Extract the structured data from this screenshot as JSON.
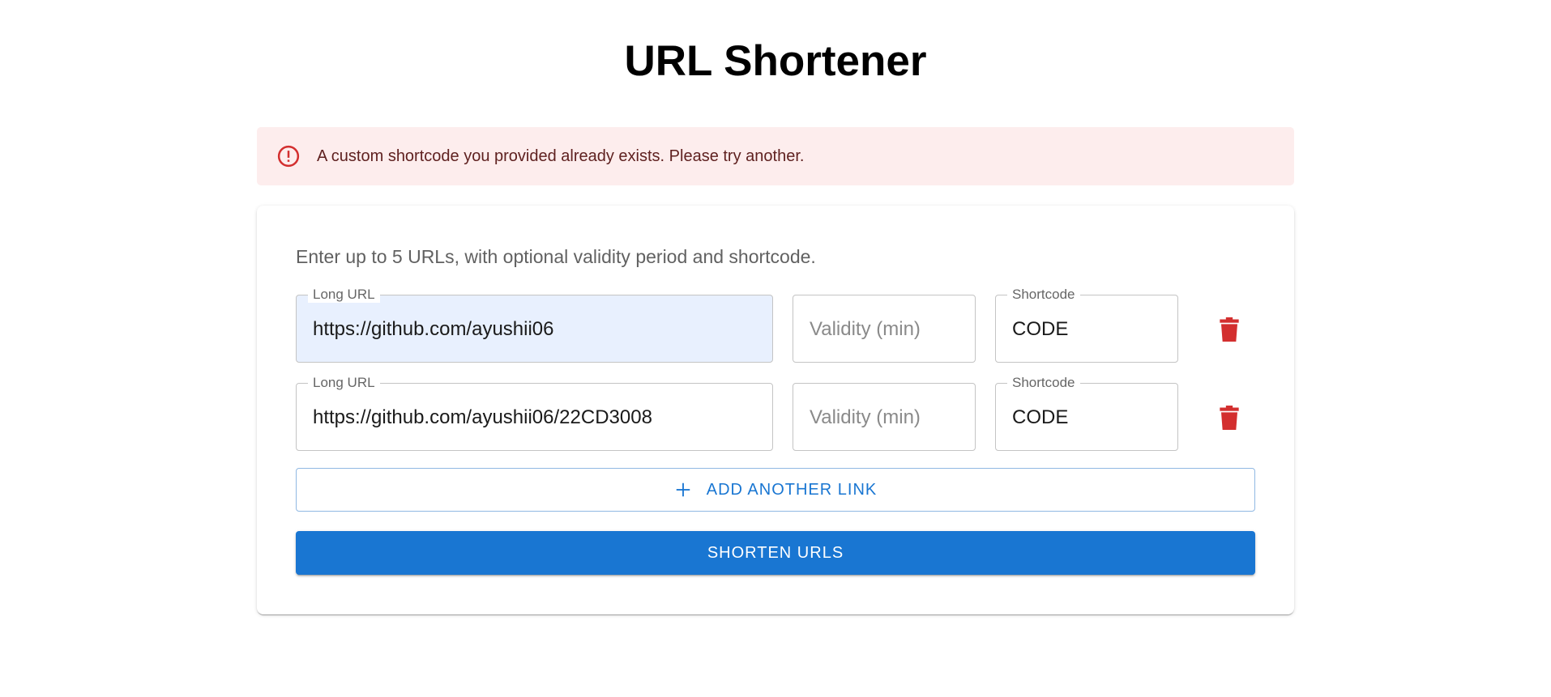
{
  "page": {
    "title": "URL Shortener"
  },
  "alert": {
    "message": "A custom shortcode you provided already exists. Please try another.",
    "icon": "error-outline-icon",
    "background": "#fdeded",
    "icon_color": "#d32f2f"
  },
  "form": {
    "instructions": "Enter up to 5 URLs, with optional validity period and shortcode.",
    "rows": [
      {
        "url_label": "Long URL",
        "url_value": "https://github.com/ayushii06",
        "validity_placeholder": "Validity (min)",
        "shortcode_label": "Shortcode",
        "shortcode_value": "CODE"
      },
      {
        "url_label": "Long URL",
        "url_value": "https://github.com/ayushii06/22CD3008",
        "validity_placeholder": "Validity (min)",
        "shortcode_label": "Shortcode",
        "shortcode_value": "CODE"
      }
    ],
    "add_button_label": "ADD ANOTHER LINK",
    "submit_button_label": "SHORTEN URLS",
    "delete_icon": "trash-icon",
    "accent_color": "#1976d2",
    "delete_color": "#d32f2f"
  }
}
